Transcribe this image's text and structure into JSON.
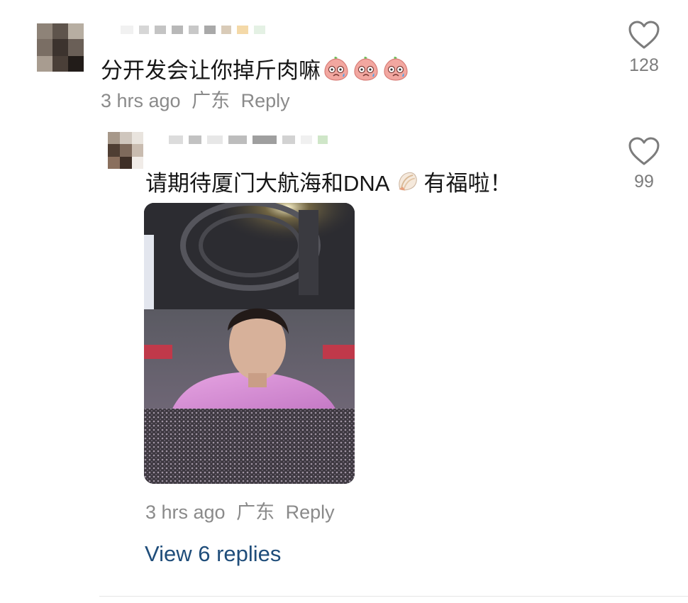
{
  "comments": [
    {
      "text": "分开发会让你掉斤肉嘛",
      "emoji": [
        "crying-peach-emoji",
        "crying-peach-emoji",
        "crying-peach-emoji"
      ],
      "time": "3 hrs ago",
      "location": "广东",
      "reply_label": "Reply",
      "like_count": "128"
    },
    {
      "text": "请期待厦门大航海和DNA",
      "emoji_mid": "shell-emoji",
      "text_tail": "有福啦！",
      "time": "3 hrs ago",
      "location": "广东",
      "reply_label": "Reply",
      "like_count": "99",
      "view_replies": "View 6 replies"
    }
  ],
  "colors": {
    "text": "#161616",
    "meta": "#8a8a8a",
    "link": "#1f4d7a",
    "icon": "#7c7c7c"
  }
}
